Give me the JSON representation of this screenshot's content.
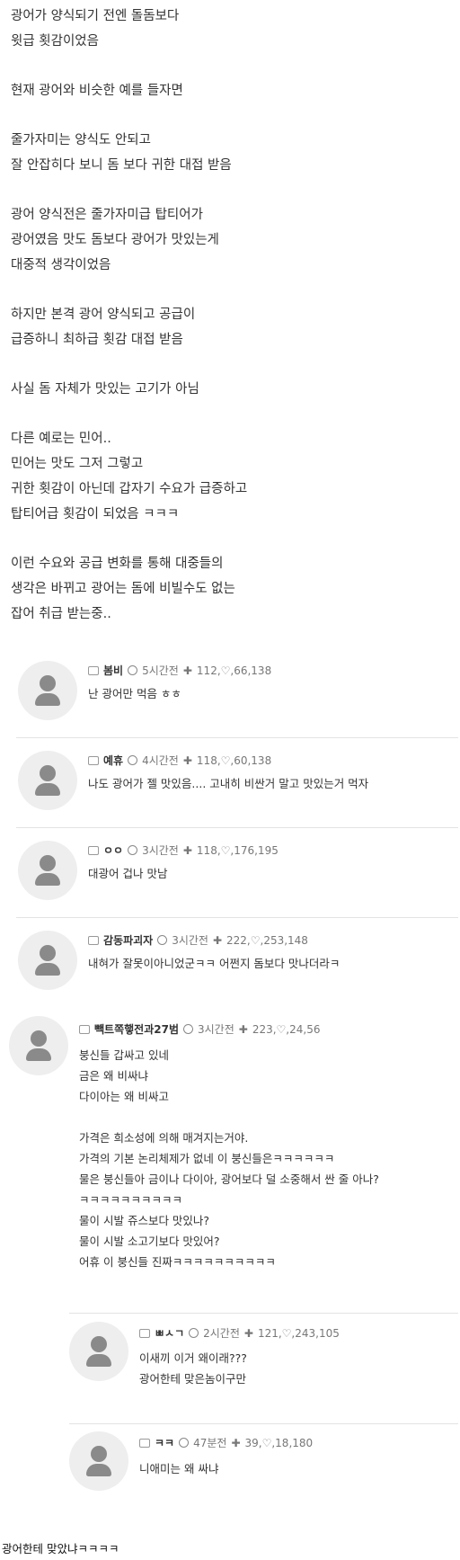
{
  "post": {
    "paragraphs": [
      [
        "광어가 양식되기 전엔 돌돔보다",
        "윗급 횟감이었음"
      ],
      [
        "현재 광어와 비슷한 예를 들자면"
      ],
      [
        "줄가자미는 양식도 안되고",
        "잘 안잡히다 보니 돔 보다 귀한 대접 받음"
      ],
      [
        "광어 양식전은 줄가자미급 탑티어가",
        "광어였음 맛도 돔보다 광어가 맛있는게",
        "대중적 생각이었음"
      ],
      [
        "하지만 본격 광어 양식되고 공급이",
        "급증하니 최하급 횟감 대접 받음"
      ],
      [
        "사실 돔 자체가 맛있는 고기가 아님"
      ],
      [
        "다른 예로는 민어..",
        "민어는 맛도 그저 그렇고",
        "귀한 횟감이 아닌데 갑자기 수요가 급증하고",
        "탑티어급 횟감이 되었음 ㅋㅋㅋ"
      ],
      [
        "이런 수요와 공급 변화를 통해 대중들의",
        "생각은 바뀌고 광어는 돔에 비빌수도 없는",
        "잡어 취급 받는중.."
      ]
    ]
  },
  "comments": [
    {
      "user": "봄비",
      "time": "5시간전",
      "stats": "112,♡,66,138",
      "lines": [
        "난 광어만 먹음 ㅎㅎ"
      ]
    },
    {
      "user": "예휴",
      "time": "4시간전",
      "stats": "118,♡,60,138",
      "lines": [
        "나도 광어가 젤 맛있음.... 고내히 비싼거 말고 맛있는거 먹자"
      ]
    },
    {
      "user": "ㅇㅇ",
      "time": "3시간전",
      "stats": "118,♡,176,195",
      "lines": [
        "대광어 겁나 맛남"
      ]
    },
    {
      "user": "감동파괴자",
      "time": "3시간전",
      "stats": "222,♡,253,148",
      "lines": [
        "내혀가 잘못이아니었군ㅋㅋ 어쩐지 돔보다 맛나더라ㅋ"
      ]
    },
    {
      "user": "빽트쪽햏전과27범",
      "time": "3시간전",
      "stats": "223,♡,24,56",
      "lines": [
        "붕신들 갑싸고 있네",
        "금은 왜 비싸냐",
        "다이아는 왜 비싸고",
        "",
        "가격은 희소성에 의해 매겨지는거야.",
        "가격의 기본 논리체제가 없네 이 붕신들은ㅋㅋㅋㅋㅋㅋ",
        "물은 붕신들아 금이나 다이아, 광어보다 덜 소중해서 싼 줄 아나?",
        "ㅋㅋㅋㅋㅋㅋㅋㅋㅋㅋ",
        "물이 시발 쥬스보다 맛있나?",
        "물이 시발 소고기보다 맛있어?",
        "어휴 이 붕신들 진짜ㅋㅋㅋㅋㅋㅋㅋㅋㅋㅋ"
      ]
    },
    {
      "user": "ㅃㅅㄱ",
      "time": "2시간전",
      "stats": "121,♡,243,105",
      "lines": [
        "이새끼 이거 왜이래???",
        "광어한테 맞은놈이구만"
      ]
    },
    {
      "user": "ㅋㅋ",
      "time": "47분전",
      "stats": "39,♡,18,180",
      "lines": [
        "니애미는 왜 싸냐"
      ]
    }
  ],
  "footer": "광어한테 맞았냐ㅋㅋㅋㅋ"
}
